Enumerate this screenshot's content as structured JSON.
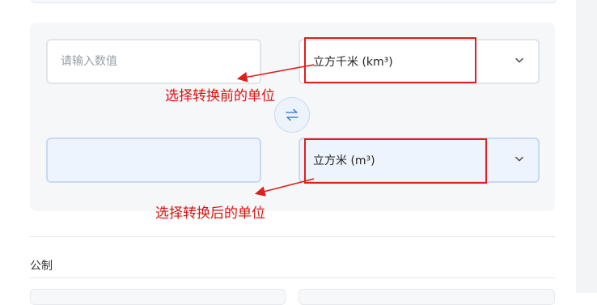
{
  "converter": {
    "input_placeholder": "请输入数值",
    "output_value": "",
    "from_unit": "立方千米 (km³)",
    "to_unit": "立方米 (m³)"
  },
  "annotations": {
    "from_label": "选择转换前的单位",
    "to_label": "选择转换后的单位"
  },
  "section": {
    "title": "公制"
  },
  "icons": {
    "swap": "swap-arrows-icon",
    "dropdown": "chevron-down-icon"
  },
  "colors": {
    "annotation_red": "#e01e1e",
    "accent_blue": "#4a86d4",
    "highlight_field": "#eef4fd"
  }
}
